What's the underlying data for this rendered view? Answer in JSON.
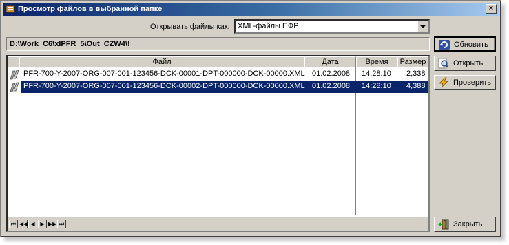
{
  "window": {
    "title": "Просмотр файлов в выбранной папке",
    "close_label": "×"
  },
  "open_as": {
    "label": "Открывать файлы как:",
    "selected": "XML-файлы ПФР"
  },
  "path": "D:\\Work_C6\\xIPFR_5\\Out_CZW4\\!",
  "table": {
    "columns": [
      "Файл",
      "Дата",
      "Время",
      "Размер"
    ],
    "rows": [
      {
        "file": "PFR-700-Y-2007-ORG-007-001-123456-DCK-00001-DPT-000000-DCK-00000.XML",
        "date": "01.02.2008",
        "time": "14:28:10",
        "size": "2,338",
        "selected": false
      },
      {
        "file": "PFR-700-Y-2007-ORG-007-001-123456-DCK-00002-DPT-000000-DCK-00000.XML",
        "date": "01.02.2008",
        "time": "14:28:10",
        "size": "4,388",
        "selected": true
      }
    ]
  },
  "navigator": [
    "⏮",
    "◀◀",
    "◀",
    "▶",
    "▶▶",
    "⏭"
  ],
  "buttons": {
    "refresh": "Обновить",
    "open": "Открыть",
    "check": "Проверить",
    "close": "Закрыть"
  }
}
